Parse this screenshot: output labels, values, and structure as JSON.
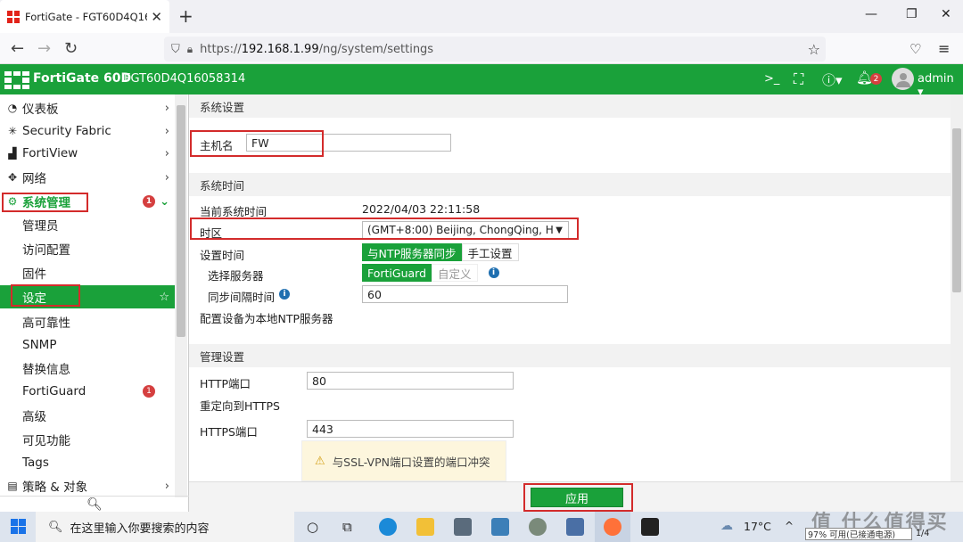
{
  "browser": {
    "tab_title": "FortiGate - FGT60D4Q16058...",
    "new_tab": "+",
    "url_prefix": "https://",
    "url_host": "192.168.1.99",
    "url_path": "/ng/system/settings"
  },
  "header": {
    "brand": "FortiGate 60D",
    "serial": "FGT60D4Q16058314",
    "notify_count": "2",
    "user": "admin"
  },
  "sidebar": {
    "items": [
      {
        "label": "仪表板",
        "icon": "dashboard-icon"
      },
      {
        "label": "Security Fabric",
        "icon": "fabric-icon"
      },
      {
        "label": "FortiView",
        "icon": "chart-icon"
      },
      {
        "label": "网络",
        "icon": "network-icon"
      },
      {
        "label": "系统管理",
        "icon": "gear-icon",
        "badge": "1"
      }
    ],
    "sub_items": [
      "管理员",
      "访问配置",
      "固件",
      "设定",
      "高可靠性",
      "SNMP",
      "替换信息",
      "FortiGuard",
      "高级",
      "可见功能",
      "Tags"
    ],
    "fortiguard_badge": "1",
    "policy": "策略 & 对象"
  },
  "main": {
    "sec_system": "系统设置",
    "hostname_label": "主机名",
    "hostname_value": "FW",
    "sec_time": "系统时间",
    "current_time_label": "当前系统时间",
    "current_time_value": "2022/04/03 22:11:58",
    "timezone_label": "时区",
    "timezone_value": "(GMT+8:00) Beijing, ChongQing, H",
    "set_time_label": "设置时间",
    "ntp_sync": "与NTP服务器同步",
    "manual_set": "手工设置",
    "select_server_label": "选择服务器",
    "server_fortiguard": "FortiGuard",
    "server_custom": "自定义",
    "sync_interval_label": "同步间隔时间",
    "sync_interval_value": "60",
    "local_ntp_label": "配置设备为本地NTP服务器",
    "sec_admin": "管理设置",
    "http_port_label": "HTTP端口",
    "http_port_value": "80",
    "redirect_https_label": "重定向到HTTPS",
    "https_port_label": "HTTPS端口",
    "https_port_value": "443",
    "warning": "与SSL-VPN端口设置的端口冲突",
    "apply": "应用"
  },
  "taskbar": {
    "search_placeholder": "在这里输入你要搜索的内容",
    "weather": "17°C",
    "battery_tooltip": "97% 可用(已接通电源)",
    "page_indicator": "1/4"
  },
  "watermark": "值 什么值得买",
  "colors": {
    "fortinet_green": "#1aa13a",
    "highlight_red": "#d32b2b",
    "info_blue": "#1f6fb0"
  }
}
